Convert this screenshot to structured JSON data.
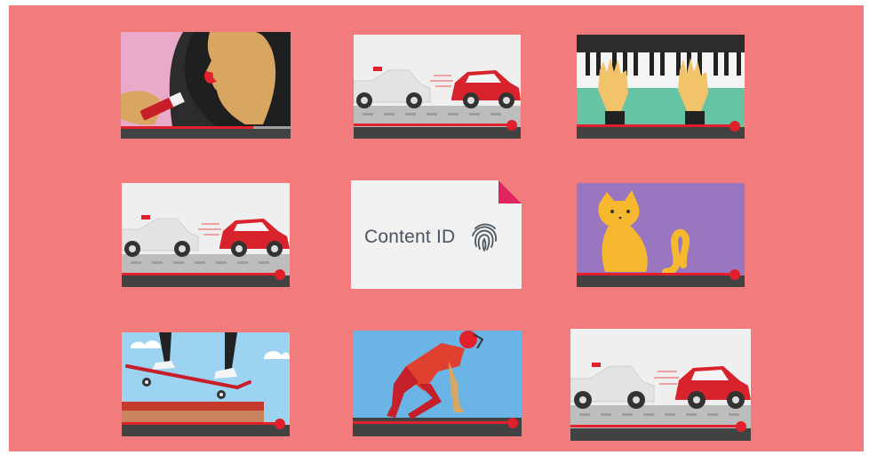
{
  "colors": {
    "background": "#f27b7c",
    "progress_played": "#e0202a",
    "progress_track": "#424242",
    "card": "#f1f1f1",
    "document_corner": "#e0245e"
  },
  "content_id": {
    "label": "Content ID",
    "icon": "fingerprint-icon"
  },
  "thumbnails": [
    {
      "scene": "lipstick",
      "progress": 0.78
    },
    {
      "scene": "police-chase",
      "progress": 0.9
    },
    {
      "scene": "piano-hands",
      "progress": 0.93
    },
    {
      "scene": "police-chase",
      "progress": 0.93
    },
    {
      "scene": "content-id-document"
    },
    {
      "scene": "cat",
      "progress": 0.93
    },
    {
      "scene": "skateboard",
      "progress": 0.93
    },
    {
      "scene": "football-player",
      "progress": 0.93
    },
    {
      "scene": "police-chase",
      "progress": 0.93
    }
  ]
}
